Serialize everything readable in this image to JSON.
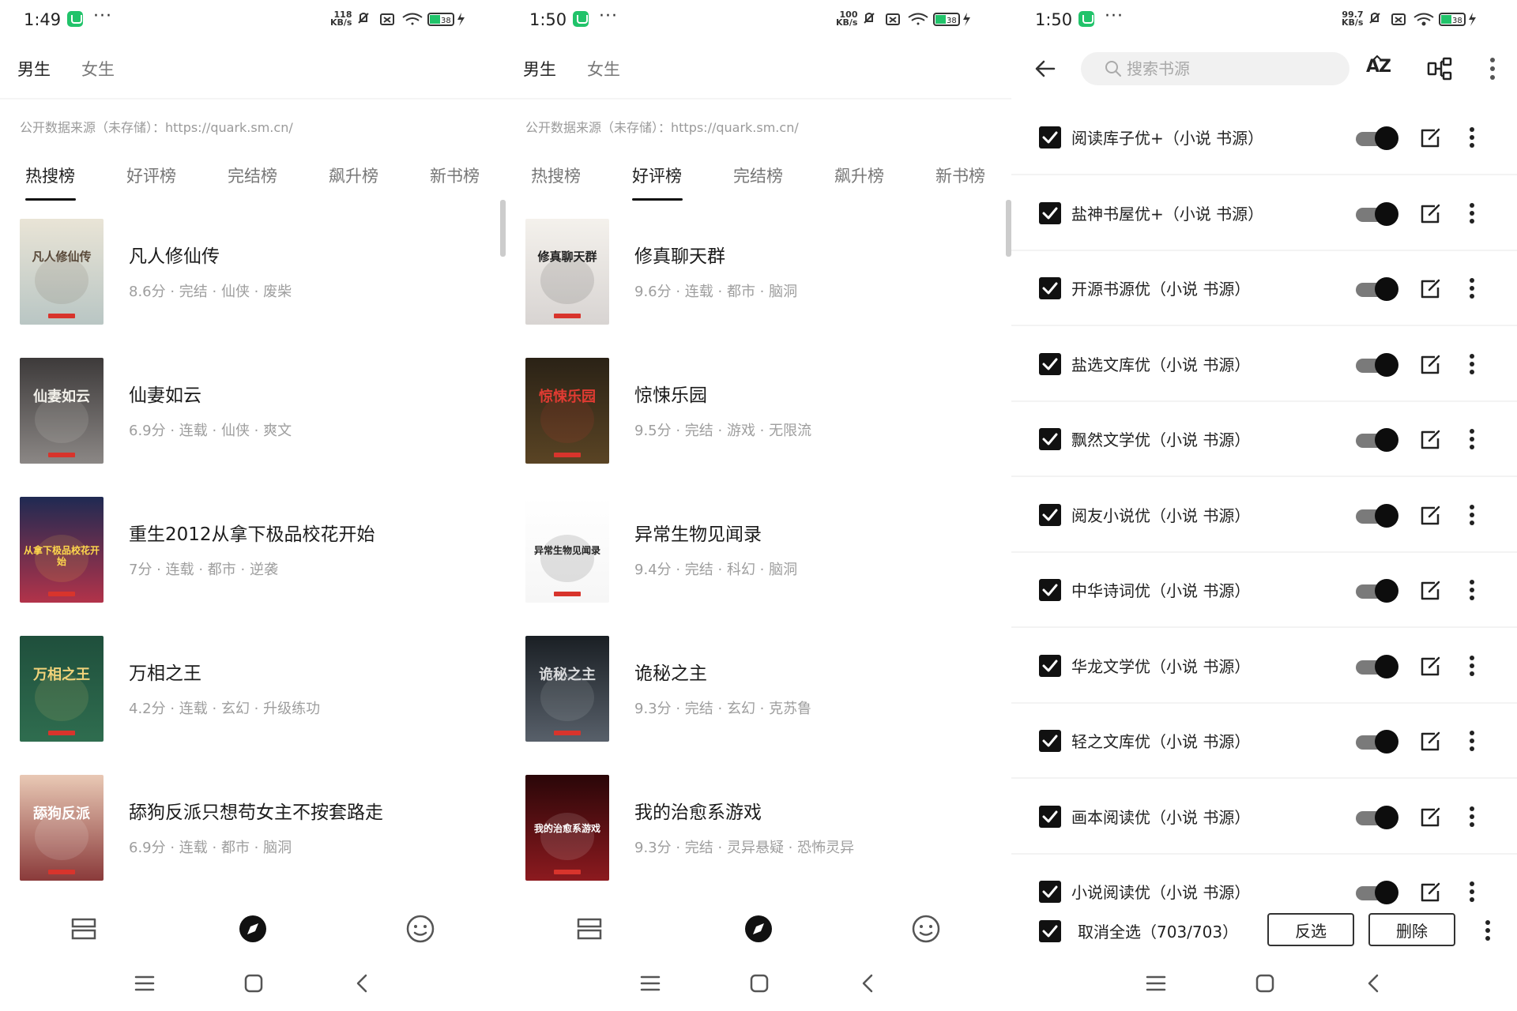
{
  "panels": [
    {
      "status": {
        "time": "1:49",
        "speed_top": "118",
        "speed_bottom": "KB/s",
        "battery": "38"
      },
      "gender": {
        "male": "男生",
        "female": "女生"
      },
      "source": "公开数据来源（未存储）：https://quark.sm.cn/",
      "tabs": [
        "热搜榜",
        "好评榜",
        "完结榜",
        "飙升榜",
        "新书榜"
      ],
      "active_tab": 0,
      "books": [
        {
          "title": "凡人修仙传",
          "meta": "8.6分 · 完结 · 仙侠 · 废柴",
          "cover": {
            "text": "凡人修仙传",
            "bg1": "#e9e4d6",
            "bg2": "#b9c6c4",
            "fg": "#5a4a3a"
          }
        },
        {
          "title": "仙妻如云",
          "meta": "6.9分 · 连载 · 仙侠 · 爽文",
          "cover": {
            "text": "仙妻如云",
            "bg1": "#3d3a3a",
            "bg2": "#8b8785",
            "fg": "#f2f0ea"
          }
        },
        {
          "title": "重生2012从拿下极品校花开始",
          "meta": "7分 · 连载 · 都市 · 逆袭",
          "cover": {
            "text": "从拿下极品校花开始",
            "bg1": "#1f2a52",
            "bg2": "#b2334a",
            "fg": "#ffd84c"
          }
        },
        {
          "title": "万相之王",
          "meta": "4.2分 · 连载 · 玄幻 · 升级练功",
          "cover": {
            "text": "万相之王",
            "bg1": "#1f4f3c",
            "bg2": "#2f6d4f",
            "fg": "#f1d37a"
          }
        },
        {
          "title": "舔狗反派只想苟女主不按套路走",
          "meta": "6.9分 · 连载 · 都市 · 脑洞",
          "cover": {
            "text": "舔狗反派",
            "bg1": "#e9c9b5",
            "bg2": "#8a3a3a",
            "fg": "#ffffff"
          }
        }
      ]
    },
    {
      "status": {
        "time": "1:50",
        "speed_top": "100",
        "speed_bottom": "KB/s",
        "battery": "38"
      },
      "gender": {
        "male": "男生",
        "female": "女生"
      },
      "source": "公开数据来源（未存储）：https://quark.sm.cn/",
      "tabs": [
        "热搜榜",
        "好评榜",
        "完结榜",
        "飙升榜",
        "新书榜"
      ],
      "active_tab": 1,
      "books": [
        {
          "title": "修真聊天群",
          "meta": "9.6分 · 连载 · 都市 · 脑洞",
          "cover": {
            "text": "修真聊天群",
            "bg1": "#f4f1ec",
            "bg2": "#d8d4d2",
            "fg": "#222222"
          }
        },
        {
          "title": "惊悚乐园",
          "meta": "9.5分 · 完结 · 游戏 · 无限流",
          "cover": {
            "text": "惊悚乐园",
            "bg1": "#2a2216",
            "bg2": "#5a4424",
            "fg": "#e13b32"
          }
        },
        {
          "title": "异常生物见闻录",
          "meta": "9.4分 · 完结 · 科幻 · 脑洞",
          "cover": {
            "text": "异常生物见闻录",
            "bg1": "#ffffff",
            "bg2": "#f6f6f6",
            "fg": "#222222"
          }
        },
        {
          "title": "诡秘之主",
          "meta": "9.3分 · 完结 · 玄幻 · 克苏鲁",
          "cover": {
            "text": "诡秘之主",
            "bg1": "#1a1f24",
            "bg2": "#58606a",
            "fg": "#d9dadc"
          }
        },
        {
          "title": "我的治愈系游戏",
          "meta": "9.3分 · 完结 · 灵异悬疑 · 恐怖灵异",
          "cover": {
            "text": "我的治愈系游戏",
            "bg1": "#2a0608",
            "bg2": "#8c1a1f",
            "fg": "#ffffff"
          }
        }
      ]
    }
  ],
  "source_manager": {
    "status": {
      "time": "1:50",
      "speed_top": "99.7",
      "speed_bottom": "KB/s",
      "battery": "38"
    },
    "search_placeholder": "搜索书源",
    "az_label": "AZ",
    "sources": [
      "阅读库子优+（小说 书源）",
      "盐神书屋优+（小说 书源）",
      "开源书源优（小说 书源）",
      "盐选文库优（小说 书源）",
      "飘然文学优（小说 书源）",
      "阅友小说优（小说 书源）",
      "中华诗词优（小说 书源）",
      "华龙文学优（小说 书源）",
      "轻之文库优（小说 书源）",
      "画本阅读优（小说 书源）",
      "小说阅读优（小说 书源）"
    ],
    "select_all_label": "取消全选（703/703）",
    "invert_label": "反选",
    "delete_label": "删除"
  },
  "colors": {
    "accent_green": "#21c36a",
    "text": "#222222",
    "muted": "#9e9e9e"
  }
}
